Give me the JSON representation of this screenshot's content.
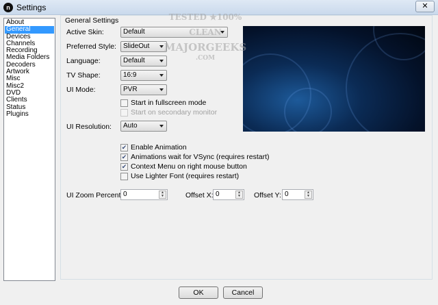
{
  "window": {
    "title": "Settings",
    "app_icon": "n",
    "close_icon": "✕"
  },
  "nav": {
    "items": [
      "About",
      "General",
      "Devices",
      "Channels",
      "Recording",
      "Media Folders",
      "Decoders",
      "Artwork",
      "Misc",
      "Misc2",
      "DVD",
      "Clients",
      "Status",
      "Plugins"
    ],
    "selected": "General"
  },
  "group": {
    "title": "General Settings"
  },
  "fields": {
    "active_skin": {
      "label": "Active Skin:",
      "value": "Default"
    },
    "preferred_style": {
      "label": "Preferred Style:",
      "value": "SlideOut"
    },
    "language": {
      "label": "Language:",
      "value": "Default"
    },
    "tv_shape": {
      "label": "TV Shape:",
      "value": "16:9"
    },
    "ui_mode": {
      "label": "UI Mode:",
      "value": "PVR"
    },
    "ui_resolution": {
      "label": "UI Resolution:",
      "value": "Auto"
    },
    "ui_zoom": {
      "label": "UI Zoom Percent:",
      "value": "0"
    },
    "offset_x": {
      "label": "Offset X:",
      "value": "0"
    },
    "offset_y": {
      "label": "Offset Y:",
      "value": "0"
    }
  },
  "checkboxes": {
    "fullscreen": {
      "label": "Start in fullscreen mode",
      "checked": false
    },
    "secondary": {
      "label": "Start on secondary monitor",
      "checked": false,
      "disabled": true
    },
    "animation": {
      "label": "Enable Animation",
      "checked": true
    },
    "vsync": {
      "label": "Animations wait for VSync (requires restart)",
      "checked": true
    },
    "context_menu": {
      "label": "Context Menu on right mouse button",
      "checked": true
    },
    "lighter_font": {
      "label": "Use Lighter Font (requires restart)",
      "checked": false
    }
  },
  "watermark": {
    "line1": "TESTED ★100% CLEAN",
    "line2": "MAJORGEEKS",
    "line3": ".COM"
  },
  "buttons": {
    "ok": "OK",
    "cancel": "Cancel"
  }
}
